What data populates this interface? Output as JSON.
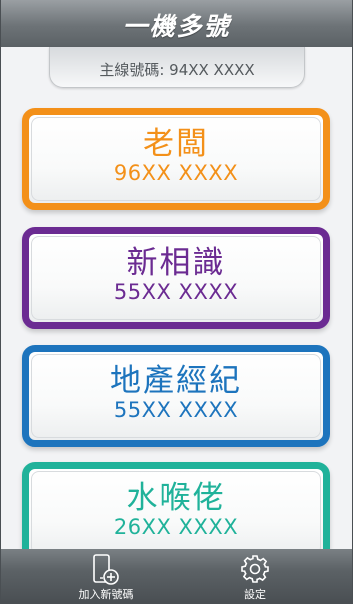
{
  "header": {
    "title": "一機多號"
  },
  "main_line": {
    "label": "主線號碼: 94XX XXXX"
  },
  "lines": [
    {
      "name": "老闆",
      "number": "96XX XXXX",
      "color": "#f39019"
    },
    {
      "name": "新相識",
      "number": "55XX XXXX",
      "color": "#6b2b92"
    },
    {
      "name": "地產經紀",
      "number": "55XX XXXX",
      "color": "#1d74bd"
    },
    {
      "name": "水喉佬",
      "number": "26XX XXXX",
      "color": "#20b29a"
    }
  ],
  "tabbar": {
    "add_label": "加入新號碼",
    "add_icon": "phone-add-icon",
    "settings_label": "設定",
    "settings_icon": "gear-icon"
  }
}
